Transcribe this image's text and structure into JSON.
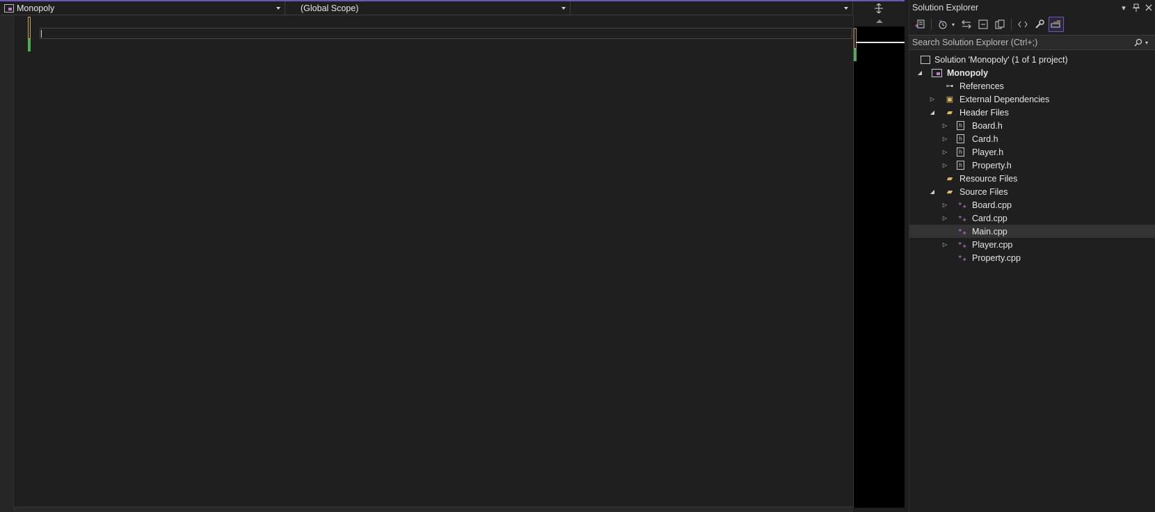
{
  "editor": {
    "nav_project": "Monopoly",
    "nav_scope": "(Global Scope)",
    "nav_member": "",
    "split_button": "⇔"
  },
  "solution_explorer": {
    "title": "Solution Explorer",
    "search_placeholder": "Search Solution Explorer (Ctrl+;)",
    "tree": {
      "solution": "Solution 'Monopoly' (1 of 1 project)",
      "project": "Monopoly",
      "references": "References",
      "external_dependencies": "External Dependencies",
      "header_files": "Header Files",
      "headers": [
        "Board.h",
        "Card.h",
        "Player.h",
        "Property.h"
      ],
      "resource_files": "Resource Files",
      "source_files": "Source Files",
      "sources": [
        "Board.cpp",
        "Card.cpp",
        "Main.cpp",
        "Player.cpp",
        "Property.cpp"
      ]
    },
    "selected_item": "Main.cpp",
    "accent_color": "#6c5ba8",
    "folder_color": "#dcb862",
    "cpp_icon_color": "#c07ad8"
  }
}
